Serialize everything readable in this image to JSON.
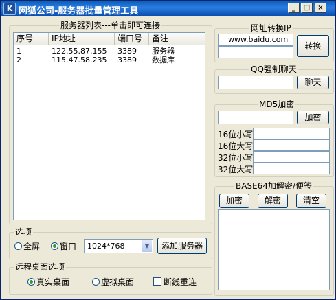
{
  "window": {
    "title": "网狐公司-服务器批量管理工具",
    "title_buttons": [
      "_",
      "□",
      "×"
    ]
  },
  "server_list": {
    "title": "服务器列表---单击即可连接",
    "columns": [
      "序号",
      "IP地址",
      "端口号",
      "备注"
    ],
    "rows": [
      [
        "1",
        "122.55.87.155",
        "3389",
        "服务器"
      ],
      [
        "2",
        "115.47.58.235",
        "3389",
        "数据库"
      ]
    ]
  },
  "options": {
    "title": "选项",
    "fullscreen_label": "全屏",
    "window_label": "窗口",
    "resolution_value": "1024*768",
    "add_server_label": "添加服务器",
    "selected": "window"
  },
  "remote_desktop": {
    "title": "远程桌面选项",
    "real_label": "真实桌面",
    "virtual_label": "虚拟桌面",
    "reconnect_label": "断线重连",
    "selected": "real"
  },
  "url_convert": {
    "title": "网址转换IP",
    "url_value": "www.baidu.com",
    "ip_value": "",
    "button_label": "转换"
  },
  "qq_chat": {
    "title": "QQ强制聊天",
    "value": "",
    "button_label": "聊天"
  },
  "md5": {
    "title": "MD5加密",
    "input_value": "",
    "button_label": "加密",
    "outputs": [
      {
        "label": "16位小写",
        "value": ""
      },
      {
        "label": "16位大写",
        "value": ""
      },
      {
        "label": "32位小写",
        "value": ""
      },
      {
        "label": "32位大写",
        "value": ""
      }
    ]
  },
  "base64": {
    "title": "BASE64加解密/便签",
    "encrypt_label": "加密",
    "decrypt_label": "解密",
    "clear_label": "清空",
    "text": ""
  }
}
